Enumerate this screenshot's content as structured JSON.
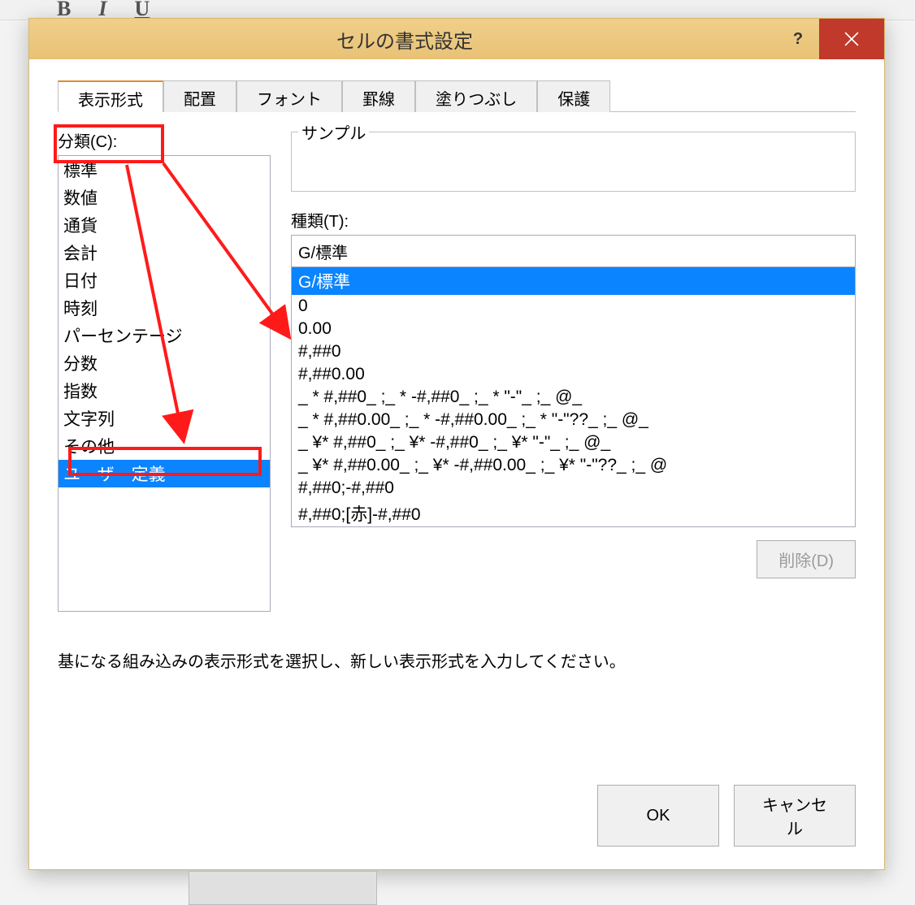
{
  "dialog": {
    "title": "セルの書式設定",
    "tabs": [
      "表示形式",
      "配置",
      "フォント",
      "罫線",
      "塗りつぶし",
      "保護"
    ],
    "category_label": "分類(C):",
    "categories": [
      "標準",
      "数値",
      "通貨",
      "会計",
      "日付",
      "時刻",
      "パーセンテージ",
      "分数",
      "指数",
      "文字列",
      "その他",
      "ユーザー定義"
    ],
    "selected_category_index": 11,
    "sample_legend": "サンプル",
    "sample_value": "",
    "type_label": "種類(T):",
    "type_input_value": "G/標準",
    "types": [
      "G/標準",
      "0",
      "0.00",
      "#,##0",
      "#,##0.00",
      "_ * #,##0_ ;_ * -#,##0_ ;_ * \"-\"_ ;_ @_",
      "_ * #,##0.00_ ;_ * -#,##0.00_ ;_ * \"-\"??_ ;_ @_",
      "_ ¥* #,##0_ ;_ ¥* -#,##0_ ;_ ¥* \"-\"_ ;_ @_",
      "_ ¥* #,##0.00_ ;_ ¥* -#,##0.00_ ;_ ¥* \"-\"??_ ;_ @",
      "#,##0;-#,##0",
      "#,##0;[赤]-#,##0"
    ],
    "selected_type_index": 0,
    "delete_button": "削除(D)",
    "description": "基になる組み込みの表示形式を選択し、新しい表示形式を入力してください。",
    "ok_button": "OK",
    "cancel_button": "キャンセル",
    "help_tooltip": "?"
  }
}
